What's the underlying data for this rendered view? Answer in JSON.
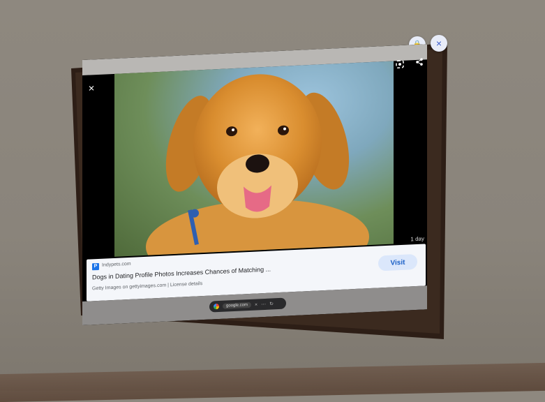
{
  "window": {
    "close_glyph": "×",
    "lock_glyph": "🔒",
    "accent": "#3b5ccc"
  },
  "viewer": {
    "close_glyph": "×",
    "lens_icon": "google-lens-icon",
    "share_icon": "share-icon",
    "date_tag": "1 day"
  },
  "result": {
    "source_badge": "P",
    "source_name": "Indypets.com",
    "title": "Dogs in Dating Profile Photos Increases Chances of Matching ...",
    "credit": "Getty Images on gettyimages.com | License details",
    "visit_label": "Visit"
  },
  "browser_bar": {
    "url": "google.com",
    "icons": [
      "×",
      "⋯",
      "↻"
    ]
  }
}
